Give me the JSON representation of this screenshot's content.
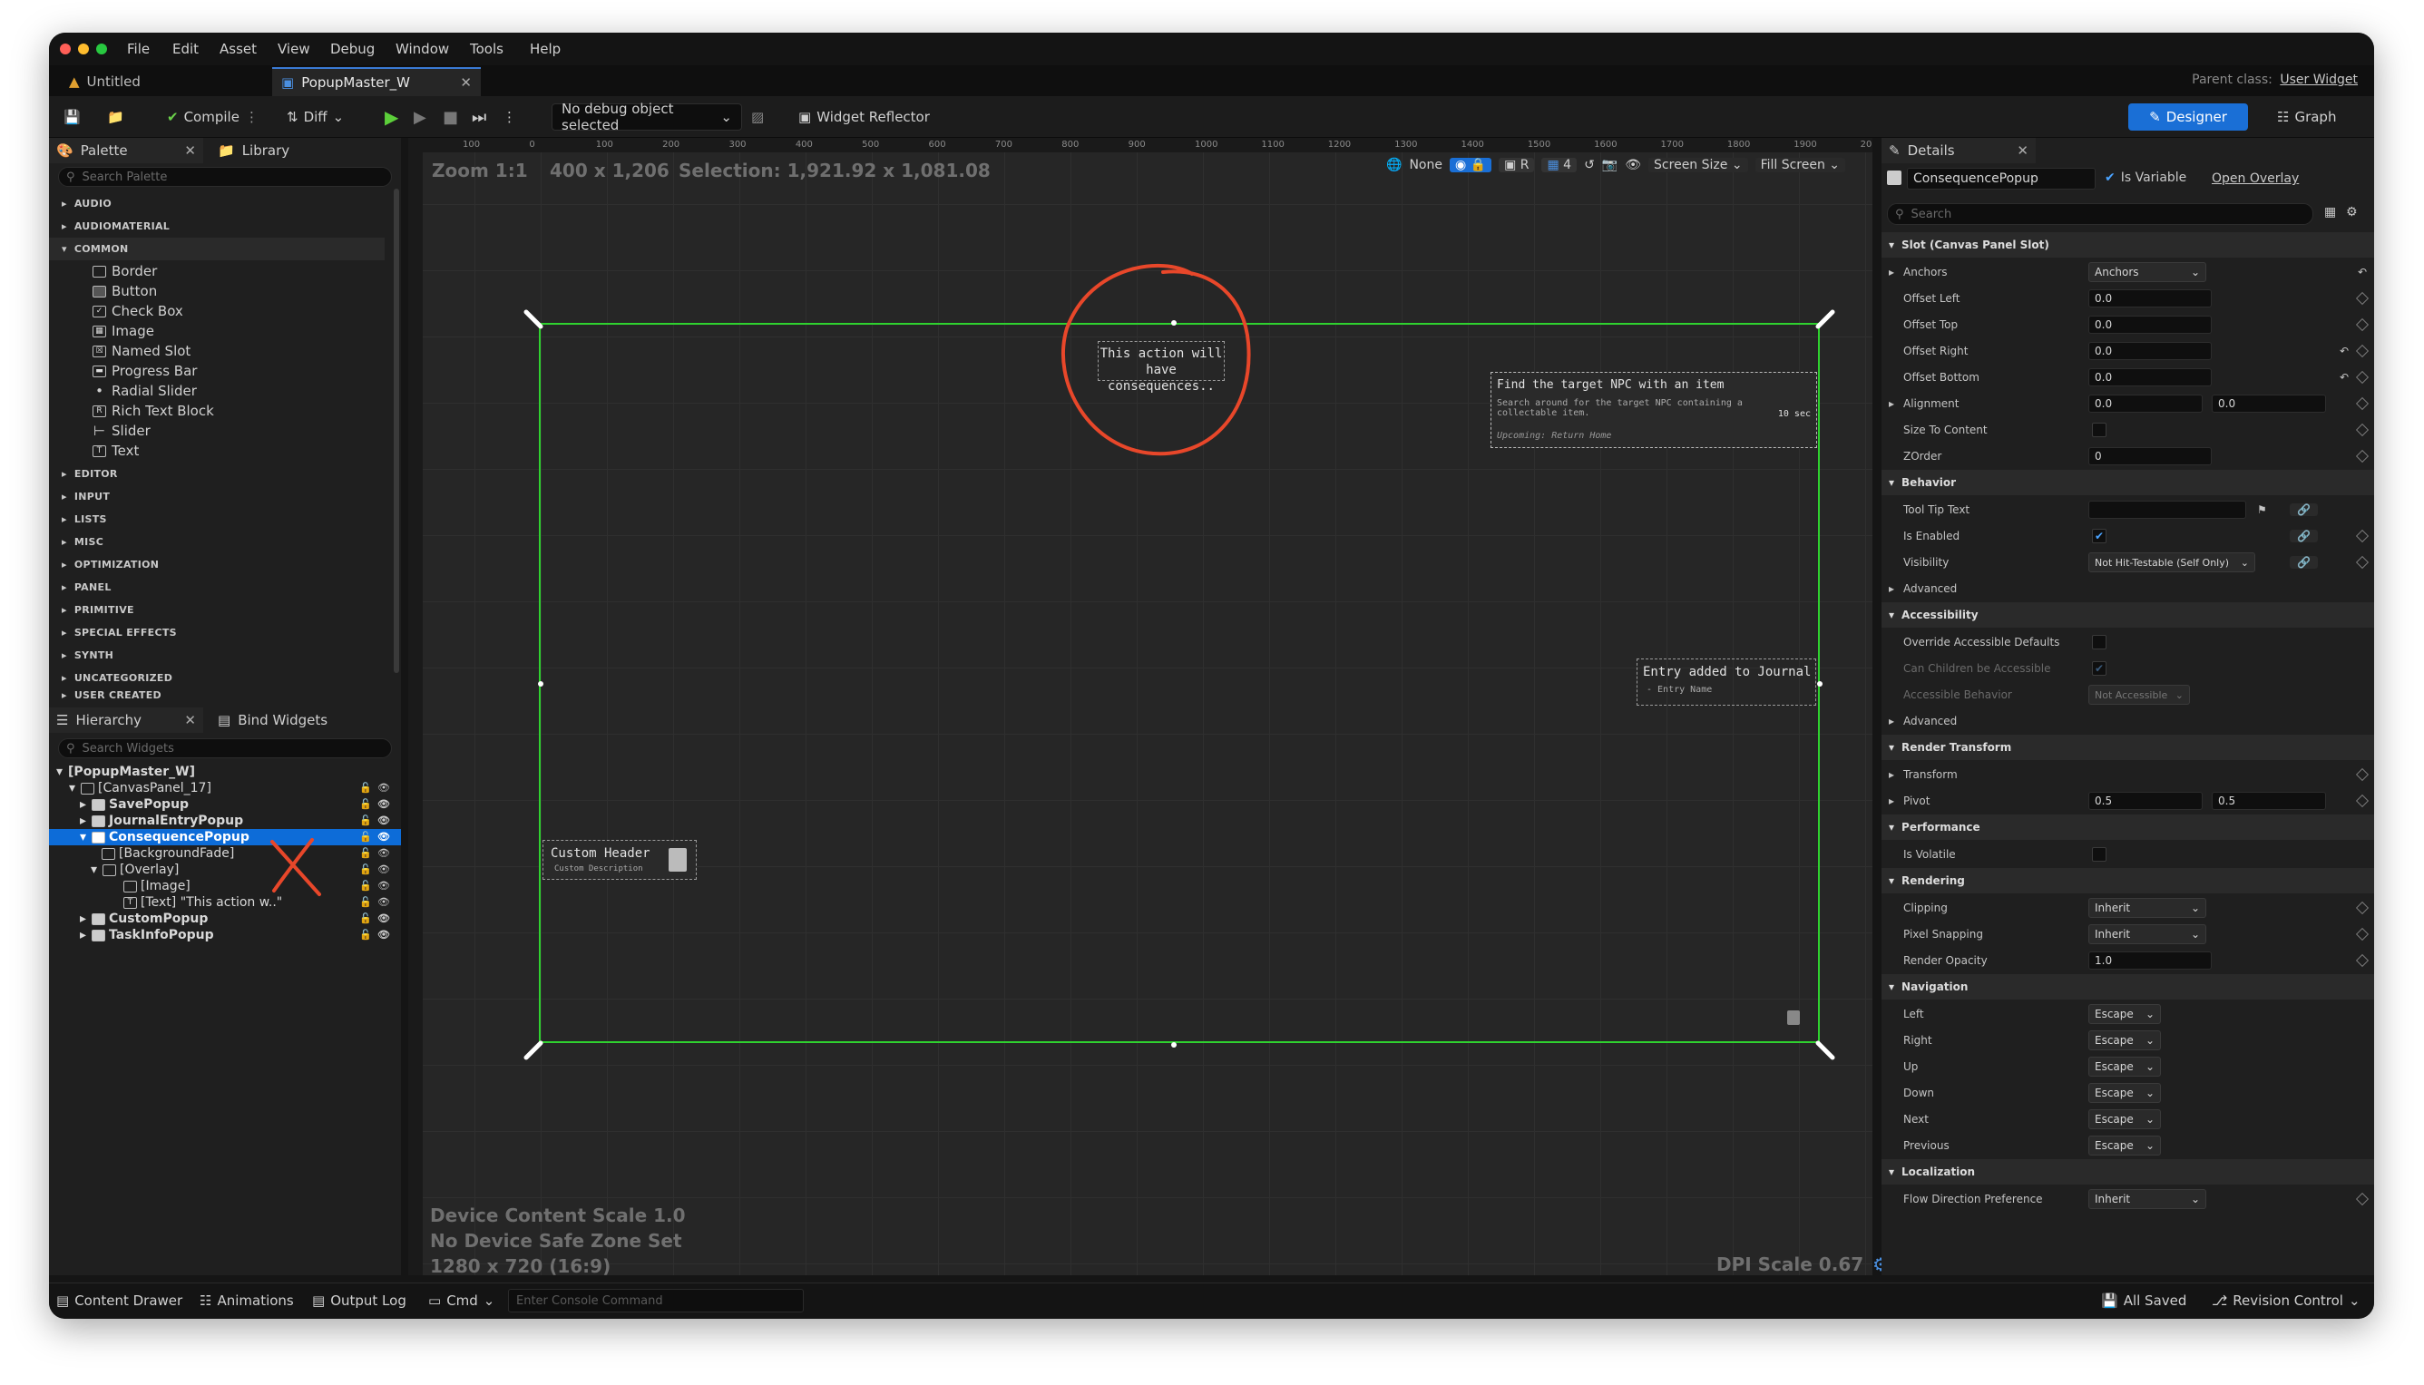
{
  "menu": [
    "File",
    "Edit",
    "Asset",
    "View",
    "Debug",
    "Window",
    "Tools",
    "Help"
  ],
  "tabs": [
    {
      "label": "Untitled"
    },
    {
      "label": "PopupMaster_W"
    }
  ],
  "parent_class": {
    "label": "Parent class:",
    "value": "User Widget"
  },
  "toolbar": {
    "compile": "Compile",
    "diff": "Diff",
    "debug_object": "No debug object selected",
    "widget_reflector": "Widget Reflector",
    "designer": "Designer",
    "graph": "Graph"
  },
  "palette": {
    "tab": "Palette",
    "library_tab": "Library",
    "search_placeholder": "Search Palette",
    "categories_top": [
      "AUDIO",
      "AUDIOMATERIAL",
      "COMMON"
    ],
    "common_items": [
      "Border",
      "Button",
      "Check Box",
      "Image",
      "Named Slot",
      "Progress Bar",
      "Radial Slider",
      "Rich Text Block",
      "Slider",
      "Text"
    ],
    "categories_bottom": [
      "EDITOR",
      "INPUT",
      "LISTS",
      "MISC",
      "OPTIMIZATION",
      "PANEL",
      "PRIMITIVE",
      "SPECIAL EFFECTS",
      "SYNTH",
      "UNCATEGORIZED",
      "USER CREATED"
    ]
  },
  "hierarchy": {
    "tab": "Hierarchy",
    "bind_tab": "Bind Widgets",
    "search_placeholder": "Search Widgets",
    "rows": [
      "[PopupMaster_W]",
      "[CanvasPanel_17]",
      "SavePopup",
      "JournalEntryPopup",
      "ConsequencePopup",
      "[BackgroundFade]",
      "[Overlay]",
      "[Image]",
      "[Text] \"This action w..\"",
      "CustomPopup",
      "TaskInfoPopup"
    ]
  },
  "canvas": {
    "zoom": "Zoom 1:1",
    "size": "400 x 1,206",
    "selection": "Selection: 1,921.92 x 1,081.08",
    "none": "None",
    "screen_size": "Screen Size",
    "fill_screen": "Fill Screen",
    "grid_num": "4",
    "ruler": [
      "100",
      "0",
      "100",
      "200",
      "300",
      "400",
      "500",
      "600",
      "700",
      "800",
      "900",
      "1000",
      "1100",
      "1200",
      "1300",
      "1400",
      "1500",
      "1600",
      "1700",
      "1800",
      "1900",
      "20"
    ],
    "device_scale": "Device Content Scale 1.0",
    "safe_zone": "No Device Safe Zone Set",
    "resolution": "1280 x 720 (16:9)",
    "dpi": "DPI Scale 0.67",
    "popup_text": "This action will have consequences..",
    "task_title": "Find the target NPC with an item",
    "task_desc": "Search around for the target NPC containing a collectable item.",
    "task_timer": "10 sec",
    "task_upcoming": "Upcoming: Return Home",
    "journal_title": "Entry added to Journal",
    "journal_sub": "- Entry Name",
    "custom_header": "Custom Header",
    "custom_desc": "Custom Description"
  },
  "details": {
    "tab": "Details",
    "name": "ConsequencePopup",
    "is_variable": "Is Variable",
    "open_overlay": "Open Overlay",
    "search_placeholder": "Search",
    "slot_section": "Slot (Canvas Panel Slot)",
    "anchors": {
      "label": "Anchors",
      "value": "Anchors"
    },
    "offset_left": {
      "label": "Offset Left",
      "value": "0.0"
    },
    "offset_top": {
      "label": "Offset Top",
      "value": "0.0"
    },
    "offset_right": {
      "label": "Offset Right",
      "value": "0.0"
    },
    "offset_bottom": {
      "label": "Offset Bottom",
      "value": "0.0"
    },
    "alignment": {
      "label": "Alignment",
      "x": "0.0",
      "y": "0.0"
    },
    "size_to_content": "Size To Content",
    "zorder": {
      "label": "ZOrder",
      "value": "0"
    },
    "behavior": "Behavior",
    "tooltip": "Tool Tip Text",
    "is_enabled": "Is Enabled",
    "visibility": {
      "label": "Visibility",
      "value": "Not Hit-Testable (Self Only)"
    },
    "advanced": "Advanced",
    "accessibility": "Accessibility",
    "override_access": "Override Accessible Defaults",
    "children_access": "Can Children be Accessible",
    "access_behavior": {
      "label": "Accessible Behavior",
      "value": "Not Accessible"
    },
    "render_transform": "Render Transform",
    "transform": "Transform",
    "pivot": {
      "label": "Pivot",
      "x": "0.5",
      "y": "0.5"
    },
    "performance": "Performance",
    "is_volatile": "Is Volatile",
    "rendering": "Rendering",
    "clipping": {
      "label": "Clipping",
      "value": "Inherit"
    },
    "pixel_snapping": {
      "label": "Pixel Snapping",
      "value": "Inherit"
    },
    "render_opacity": {
      "label": "Render Opacity",
      "value": "1.0"
    },
    "navigation": "Navigation",
    "nav": [
      {
        "label": "Left",
        "value": "Escape"
      },
      {
        "label": "Right",
        "value": "Escape"
      },
      {
        "label": "Up",
        "value": "Escape"
      },
      {
        "label": "Down",
        "value": "Escape"
      },
      {
        "label": "Next",
        "value": "Escape"
      },
      {
        "label": "Previous",
        "value": "Escape"
      }
    ],
    "localization": "Localization",
    "flow_direction": {
      "label": "Flow Direction Preference",
      "value": "Inherit"
    }
  },
  "status": {
    "content_drawer": "Content Drawer",
    "animations": "Animations",
    "output_log": "Output Log",
    "cmd": "Cmd",
    "console_placeholder": "Enter Console Command",
    "all_saved": "All Saved",
    "revision": "Revision Control"
  },
  "colors": {
    "accent": "#1a6fd6",
    "selection_green": "#2fd12f",
    "annotation_red": "#e8472a",
    "background": "#262626"
  }
}
